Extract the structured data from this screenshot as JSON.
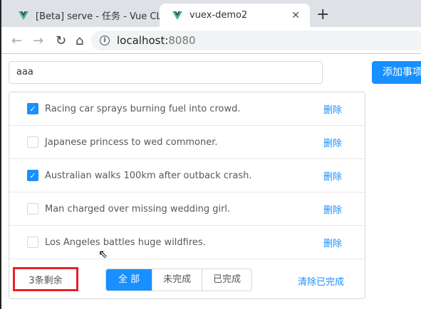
{
  "browser": {
    "tabs": [
      {
        "title": "[Beta] serve - 任务 - Vue CLI",
        "active": false
      },
      {
        "title": "vuex-demo2",
        "active": true
      }
    ],
    "url_host": "localhost:",
    "url_port": "8080"
  },
  "todo": {
    "input_value": "aaa",
    "add_label": "添加事项",
    "items": [
      {
        "text": "Racing car sprays burning fuel into crowd.",
        "done": true
      },
      {
        "text": "Japanese princess to wed commoner.",
        "done": false
      },
      {
        "text": "Australian walks 100km after outback crash.",
        "done": true
      },
      {
        "text": "Man charged over missing wedding girl.",
        "done": false
      },
      {
        "text": "Los Angeles battles huge wildfires.",
        "done": false
      }
    ],
    "delete_label": "删除",
    "remaining": "3条剩余",
    "filters": [
      "全 部",
      "未完成",
      "已完成"
    ],
    "active_filter": "全 部",
    "clear_label": "清除已完成"
  },
  "colors": {
    "accent": "#1890ff",
    "highlight": "#e8202a"
  }
}
